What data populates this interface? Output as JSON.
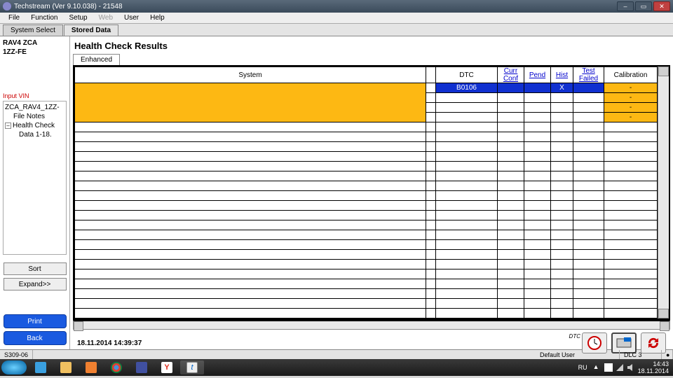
{
  "window": {
    "title": "Techstream (Ver 9.10.038) - 21548"
  },
  "menu": {
    "file": "File",
    "function": "Function",
    "setup": "Setup",
    "web": "Web",
    "user": "User",
    "help": "Help"
  },
  "tabs": {
    "system_select": "System Select",
    "stored_data": "Stored Data"
  },
  "sidebar": {
    "vehicle_line1": "RAV4 ZCA",
    "vehicle_line2": "1ZZ-FE",
    "input_vin": "Input VIN",
    "tree_root": "ZCA_RAV4_1ZZ-",
    "tree_notes": "File Notes",
    "tree_hc": "Health Check",
    "tree_data": "Data 1-18.",
    "sort": "Sort",
    "expand": "Expand>>",
    "print": "Print",
    "back": "Back"
  },
  "content": {
    "title": "Health Check Results",
    "subtab": "Enhanced",
    "headers": {
      "system": "System",
      "dtc": "DTC",
      "curr_conf": "Curr Conf",
      "pend": "Pend",
      "hist": "Hist",
      "test_failed": "Test Failed",
      "calibration": "Calibration"
    },
    "rows": [
      {
        "system": "",
        "dtc": "B0106",
        "cc": "",
        "pend": "",
        "hist": "X",
        "tf": "",
        "cal": "-",
        "hl": true,
        "sel": true
      },
      {
        "system": "",
        "dtc": "",
        "cc": "",
        "pend": "",
        "hist": "",
        "tf": "",
        "cal": "-",
        "hl": true
      },
      {
        "system": "",
        "dtc": "",
        "cc": "",
        "pend": "",
        "hist": "",
        "tf": "",
        "cal": "-",
        "hl": true
      },
      {
        "system": "",
        "dtc": "",
        "cc": "",
        "pend": "",
        "hist": "",
        "tf": "",
        "cal": "-",
        "hl": true
      }
    ],
    "timestamp": "18.11.2014 14:39:37"
  },
  "statusbar": {
    "left": "S309-06",
    "user": "Default User",
    "dlc": "DLC 3"
  },
  "taskbar": {
    "lang": "RU",
    "time": "14:43",
    "date": "18.11.2014"
  }
}
